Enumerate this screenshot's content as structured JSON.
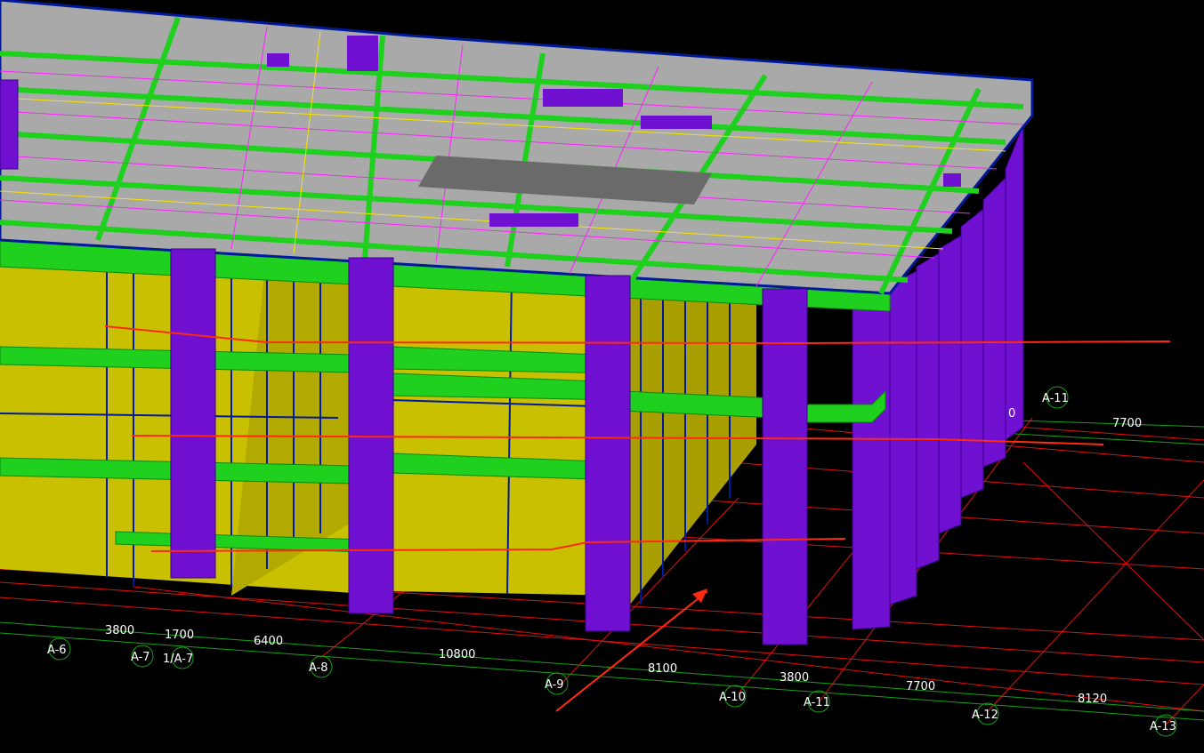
{
  "colors": {
    "background": "#000000",
    "slab_top": "#a9a9a9",
    "beam": "#1fd01f",
    "column": "#7010d0",
    "wall": "#c8c000",
    "edge": "#001a9a",
    "grid_line": "#e01010",
    "grid_line_alt": "#18a018",
    "marker": "#ff2a10",
    "dim_text": "#ffffff"
  },
  "axes": [
    {
      "label": "A-6"
    },
    {
      "label": "A-7"
    },
    {
      "label": "1/A-7"
    },
    {
      "label": "A-8"
    },
    {
      "label": "A-9"
    },
    {
      "label": "A-10"
    },
    {
      "label": "A-11"
    },
    {
      "label": "A-12"
    },
    {
      "label": "A-13"
    },
    {
      "label": "A-11"
    }
  ],
  "dimensions": [
    {
      "value": "3800"
    },
    {
      "value": "1700"
    },
    {
      "value": "6400"
    },
    {
      "value": "10800"
    },
    {
      "value": "8100"
    },
    {
      "value": "3800"
    },
    {
      "value": "7700"
    },
    {
      "value": "8120"
    },
    {
      "value": "7700"
    },
    {
      "value": "0"
    }
  ]
}
